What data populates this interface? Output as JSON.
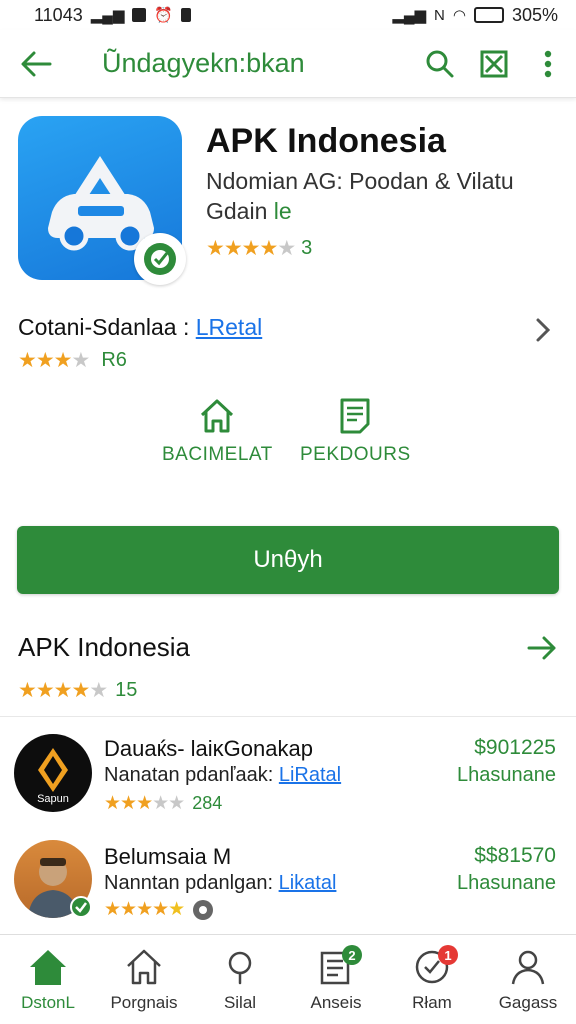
{
  "status_bar": {
    "time": "11043",
    "battery": "305%"
  },
  "toolbar": {
    "title": "Ũndagyekn:bkan"
  },
  "app": {
    "name": "APK Indonesia",
    "developer": "Ndomian AG: Poodan & Vilatu",
    "category_prefix": "Gdain",
    "category_suffix": "le",
    "rating_count": "3"
  },
  "content": {
    "label": "Cotani-Sdanlaa :",
    "link": "LRetal",
    "rating_value": "R6"
  },
  "actions": [
    {
      "label": "BACIMELAT",
      "icon": "home-outline-icon"
    },
    {
      "label": "PEKDOURS",
      "icon": "document-icon"
    }
  ],
  "install_button": {
    "label": "Unθyh"
  },
  "section": {
    "title": "APK Indonesia",
    "rating_count": "15"
  },
  "list": [
    {
      "title": "Dauaќs- laiĸGonakap",
      "subtitle_prefix": "Nanatan pdanľaak:",
      "subtitle_link": "LiRatal",
      "rating_count": "284",
      "price": "$901225",
      "status": "Lhasunane",
      "avatar_text": "Sapun"
    },
    {
      "title": "Belumsaia M",
      "subtitle_prefix": "Nanntan pdanlgan:",
      "subtitle_link": "Likatal",
      "rating_count": "",
      "price": "$$81570",
      "status": "Lhasunane",
      "avatar_text": ""
    }
  ],
  "bottom_nav": [
    {
      "label": "DstonL",
      "icon": "home-filled-icon",
      "active": true,
      "badge": ""
    },
    {
      "label": "Porgnais",
      "icon": "home-outline-icon",
      "active": false,
      "badge": ""
    },
    {
      "label": "Silal",
      "icon": "search-icon",
      "active": false,
      "badge": ""
    },
    {
      "label": "Anseis",
      "icon": "list-icon",
      "active": false,
      "badge": "2"
    },
    {
      "label": "Rłam",
      "icon": "check-circle-icon",
      "active": false,
      "badge": "1"
    },
    {
      "label": "Gagass",
      "icon": "person-icon",
      "active": false,
      "badge": ""
    }
  ],
  "colors": {
    "accent": "#2e8b3a",
    "link": "#1a73e8",
    "star": "#f0a020",
    "badge_green": "#2e8b3a",
    "badge_red": "#e53935"
  }
}
